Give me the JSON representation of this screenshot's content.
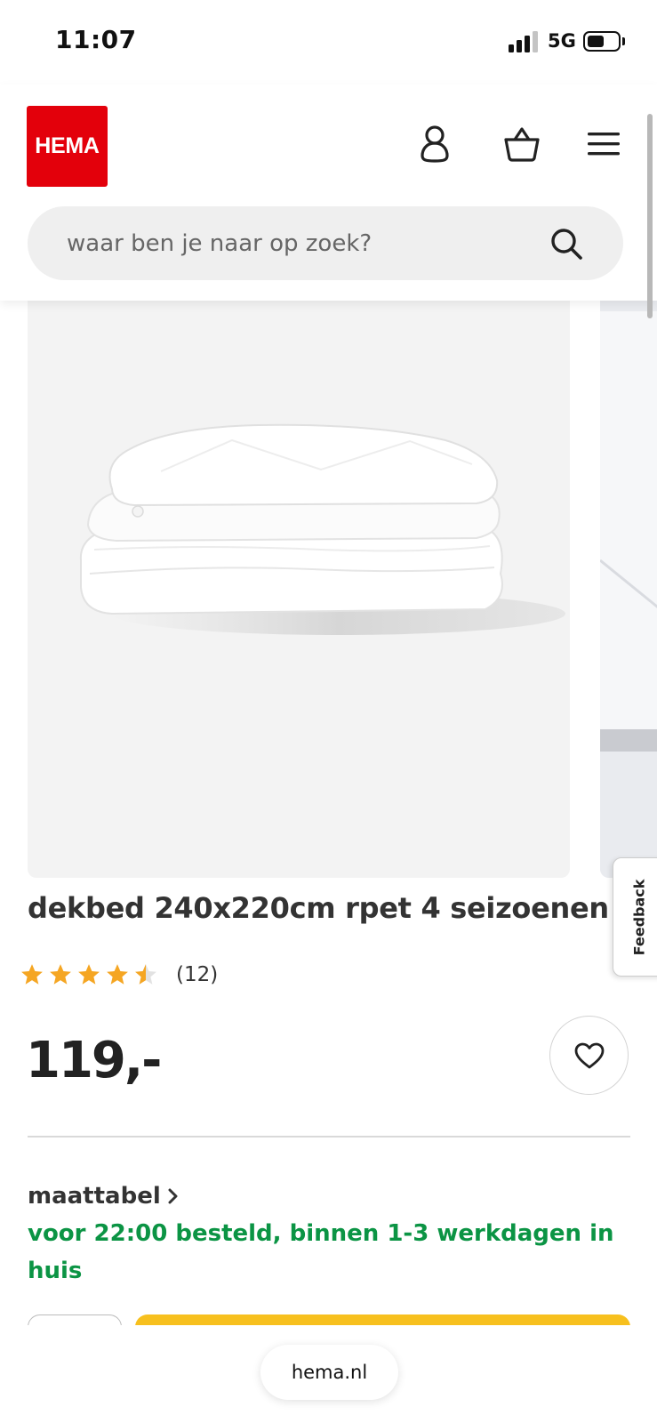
{
  "status_bar": {
    "time": "11:07",
    "network": "5G"
  },
  "header": {
    "logo_text": "HEMA",
    "search": {
      "placeholder": "waar ben je naar op zoek?",
      "value": ""
    },
    "icons": [
      "account-icon",
      "basket-icon",
      "menu-icon"
    ]
  },
  "feedback": {
    "label": "Feedback"
  },
  "product": {
    "title": "dekbed 240x220cm rpet 4 seizoenen",
    "rating": {
      "value": 4.5,
      "max": 5,
      "count_label": "(12)"
    },
    "price": "119,-",
    "size_link": "maattabel",
    "delivery": "voor 22:00 besteld, binnen 1-3 werkdagen in huis"
  },
  "browser": {
    "url": "hema.nl"
  },
  "colors": {
    "brand_red": "#e3000b",
    "delivery_green": "#0b9444",
    "cta_yellow": "#f7c01e",
    "star": "#f5a623"
  }
}
